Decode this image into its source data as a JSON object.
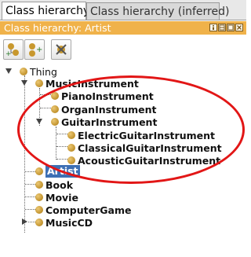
{
  "tabs": [
    {
      "label": "Class hierarchy"
    },
    {
      "label": "Class hierarchy (inferred)"
    }
  ],
  "view": {
    "title": "Class hierarchy: Artist"
  },
  "toolbar": {
    "buttons": [
      {
        "icon": "add-subclass-icon"
      },
      {
        "icon": "add-sibling-icon"
      },
      {
        "icon": "delete-class-icon"
      }
    ]
  },
  "tree": {
    "root": "Thing",
    "music_instrument": "MusicInstrument",
    "piano": "PianoInstrument",
    "organ": "OrganInstrument",
    "guitar": "GuitarInstrument",
    "electric": "ElectricGuitarInstrument",
    "classical": "ClassicalGuitarInstrument",
    "acoustic": "AcousticGuitarInstrument",
    "artist": "Artist",
    "book": "Book",
    "movie": "Movie",
    "computer_game": "ComputerGame",
    "music_cd": "MusicCD"
  },
  "selected": "Artist",
  "colors": {
    "header": "#f0b24a",
    "selection": "#3d6fb4",
    "annotation": "#e21616",
    "class_dot": "#c0912c"
  }
}
